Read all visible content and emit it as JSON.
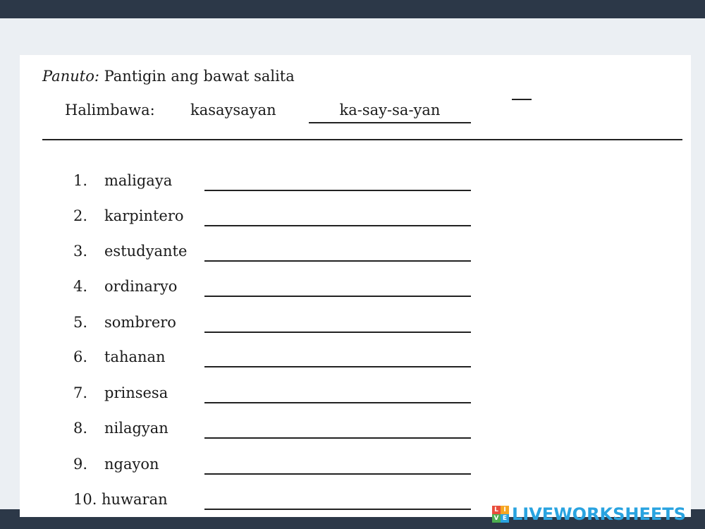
{
  "worksheet": {
    "instruction_label": "Panuto:",
    "instruction_text": " Pantigin ang bawat salita",
    "example_label": "Halimbawa:",
    "example_word": "kasaysayan",
    "example_answer": "ka-say-sa-yan",
    "items": [
      {
        "number": "1.",
        "word": "maligaya"
      },
      {
        "number": "2.",
        "word": "karpintero"
      },
      {
        "number": "3.",
        "word": "estudyante"
      },
      {
        "number": "4.",
        "word": "ordinaryo"
      },
      {
        "number": "5.",
        "word": "sombrero"
      },
      {
        "number": "6.",
        "word": "tahanan"
      },
      {
        "number": "7.",
        "word": "prinsesa"
      },
      {
        "number": "8.",
        "word": "nilagyan"
      },
      {
        "number": "9.",
        "word": "ngayon"
      },
      {
        "number": "10.",
        "word": "huwaran"
      }
    ]
  },
  "brand": {
    "text": "LIVEWORKSHEETS",
    "icon_letters": [
      "L",
      "I",
      "V",
      "E"
    ],
    "icon_colors": [
      "#e94e3c",
      "#f5a623",
      "#4caf50",
      "#29a3e0"
    ],
    "text_color": "#29a3e0"
  }
}
